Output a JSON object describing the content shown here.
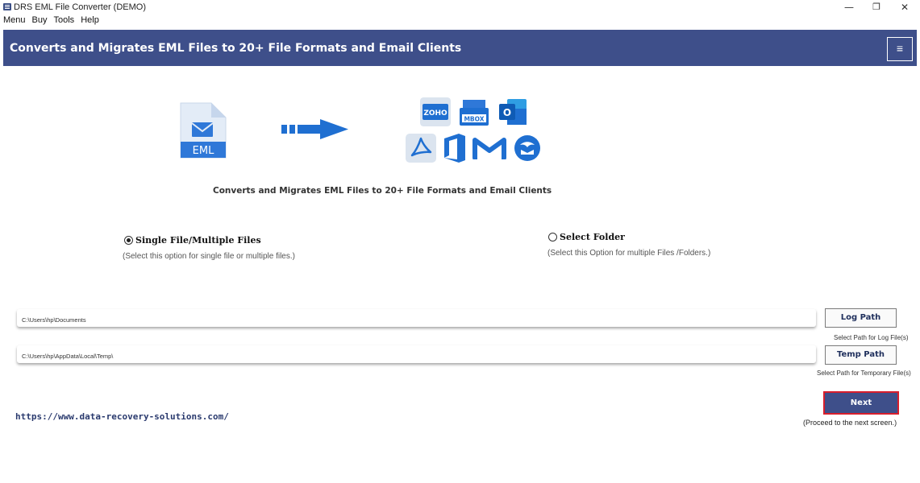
{
  "window": {
    "title": "DRS EML File Converter (DEMO)",
    "controls": {
      "minimize": "—",
      "maximize": "❐",
      "close": "✕"
    }
  },
  "menu": {
    "items": [
      "Menu",
      "Buy",
      "Tools",
      "Help"
    ]
  },
  "banner": {
    "title": "Converts and Migrates EML Files to 20+ File Formats and Email Clients",
    "menu_glyph": "≡",
    "color": "#3e4f8a"
  },
  "illustration": {
    "source_label": "EML",
    "target_icons": [
      "zoho-icon",
      "mbox-icon",
      "outlook-icon",
      "pdf-icon",
      "office365-icon",
      "gmail-icon",
      "thunderbird-icon"
    ],
    "zoho_label": "ZOHO",
    "mbox_label": "MBOX",
    "outlook_label": "O"
  },
  "subtitle": "Converts and Migrates EML Files to 20+ File Formats and Email Clients",
  "options": {
    "single": {
      "label": "Single File/Multiple Files",
      "hint": "(Select this option for single file or multiple files.)",
      "selected": true
    },
    "folder": {
      "label": "Select Folder",
      "hint": "(Select this Option for multiple Files /Folders.)",
      "selected": false
    }
  },
  "paths": {
    "log": {
      "value": "C:\\Users\\hp\\Documents",
      "button": "Log Path",
      "hint": "Select Path for Log File(s)"
    },
    "temp": {
      "value": "C:\\Users\\hp\\AppData\\Local\\Temp\\",
      "button": "Temp Path",
      "hint": "Select Path for Temporary File(s)"
    }
  },
  "footer": {
    "link": "https://www.data-recovery-solutions.com/",
    "next_button": "Next",
    "next_hint": "(Proceed to the next screen.)"
  },
  "colors": {
    "accent": "#3e4f8a",
    "next_border": "#d81e2c",
    "icon_blue": "#1f6fd1"
  }
}
